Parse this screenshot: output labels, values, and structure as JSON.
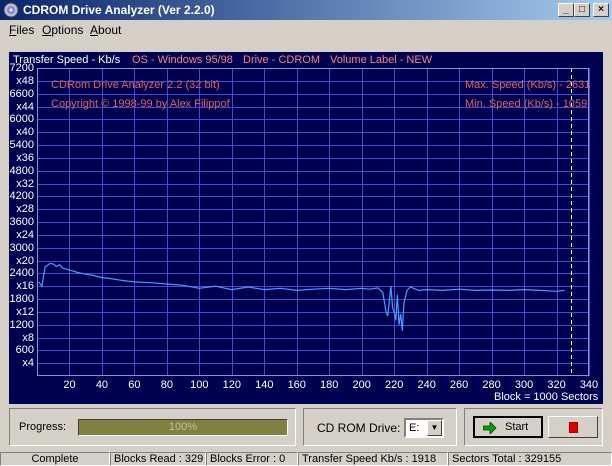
{
  "window": {
    "title": "CDROM Drive Analyzer (Ver 2.2.0)",
    "buttons": {
      "minimize": "_",
      "maximize": "□",
      "close": "×"
    }
  },
  "menu": [
    {
      "label": "Files",
      "mnemonic": "F",
      "rest": "iles"
    },
    {
      "label": "Options",
      "mnemonic": "O",
      "rest": "ptions"
    },
    {
      "label": "About",
      "mnemonic": "A",
      "rest": "bout"
    }
  ],
  "graph_header": {
    "transfer_speed": "Transfer Speed - Kb/s",
    "os": "OS - Windows 95/98",
    "drive": "Drive - CDROM",
    "volume": "Volume Label - NEW"
  },
  "graph_info": {
    "app_name": "CDRom Drive Analyzer 2.2 (32 bit)",
    "copyright": "Copyright © 1998-99 by Alex Filippof",
    "max_speed": "Max. Speed (Kb/s) - 2631",
    "min_speed": "Min.  Speed (Kb/s) - 1059",
    "block_note": "Block = 1000 Sectors"
  },
  "colors": {
    "graph_bg": "#000050",
    "grid": "#4a4ac8",
    "line": "#40a0ff",
    "header_speed": "#ffffff",
    "header_info": "#ff8080",
    "info_text": "#e06060",
    "progress_fill": "#808040"
  },
  "chart_data": {
    "type": "line",
    "title": "Transfer Speed - Kb/s",
    "xlabel": "Block = 1000 Sectors",
    "ylabel": "Transfer Speed - Kb/s",
    "xlim": [
      0,
      340
    ],
    "ylim": [
      0,
      7200
    ],
    "x_ticks": [
      20,
      40,
      60,
      80,
      100,
      120,
      140,
      160,
      180,
      200,
      220,
      240,
      260,
      280,
      300,
      320,
      340
    ],
    "y_ticks": [
      {
        "value": 7200,
        "label": "7200"
      },
      {
        "value": 6900,
        "label": "x48"
      },
      {
        "value": 6600,
        "label": "6600"
      },
      {
        "value": 6300,
        "label": "x44"
      },
      {
        "value": 6000,
        "label": "6000"
      },
      {
        "value": 5700,
        "label": "x40"
      },
      {
        "value": 5400,
        "label": "5400"
      },
      {
        "value": 5100,
        "label": "x36"
      },
      {
        "value": 4800,
        "label": "4800"
      },
      {
        "value": 4500,
        "label": "x32"
      },
      {
        "value": 4200,
        "label": "4200"
      },
      {
        "value": 3900,
        "label": "x28"
      },
      {
        "value": 3600,
        "label": "3600"
      },
      {
        "value": 3300,
        "label": "x24"
      },
      {
        "value": 3000,
        "label": "3000"
      },
      {
        "value": 2700,
        "label": "x20"
      },
      {
        "value": 2400,
        "label": "2400"
      },
      {
        "value": 2100,
        "label": "x16"
      },
      {
        "value": 1800,
        "label": "1800"
      },
      {
        "value": 1500,
        "label": "x12"
      },
      {
        "value": 1200,
        "label": "1200"
      },
      {
        "value": 900,
        "label": "x8"
      },
      {
        "value": 600,
        "label": "600"
      },
      {
        "value": 300,
        "label": "x4"
      }
    ],
    "grid": true,
    "marker_x": 329,
    "series": [
      {
        "x": [
          1,
          3,
          5,
          8,
          10,
          12,
          14,
          16,
          18,
          20,
          25,
          30,
          35,
          40,
          45,
          50,
          55,
          60,
          70,
          80,
          90,
          100,
          110,
          120,
          130,
          140,
          150,
          160,
          170,
          180,
          190,
          200,
          205,
          210,
          213,
          215,
          216,
          218,
          219,
          220,
          221,
          222,
          223,
          224,
          225,
          226,
          228,
          230,
          235,
          240,
          250,
          260,
          270,
          280,
          290,
          300,
          310,
          320,
          325
        ],
        "y": [
          2200,
          2100,
          2550,
          2631,
          2620,
          2560,
          2600,
          2520,
          2500,
          2480,
          2420,
          2380,
          2350,
          2300,
          2280,
          2250,
          2220,
          2200,
          2180,
          2150,
          2120,
          2050,
          2100,
          2020,
          2080,
          2020,
          2050,
          2000,
          2030,
          2050,
          2020,
          2050,
          2030,
          2060,
          1950,
          1500,
          1400,
          2100,
          1600,
          1500,
          1300,
          1900,
          1200,
          1450,
          1059,
          1700,
          2000,
          2080,
          2000,
          2020,
          2000,
          2030,
          2000,
          2010,
          2000,
          2020,
          2000,
          1980,
          2000
        ]
      }
    ]
  },
  "progress": {
    "label": "Progress:",
    "value": 1.0,
    "text": "100%"
  },
  "drive": {
    "label": "CD ROM Drive:",
    "value": "E:"
  },
  "start_button": {
    "label": "Start",
    "icon": "green-arrow-icon"
  },
  "stop_button": {
    "icon": "red-stop-icon"
  },
  "status": {
    "state": "Complete",
    "blocks_read": "Blocks Read : 329",
    "blocks_error": "Blocks Error : 0",
    "transfer_speed": "Transfer Speed Kb/s : 1918",
    "sectors_total": "Sectors Total : 329155"
  }
}
